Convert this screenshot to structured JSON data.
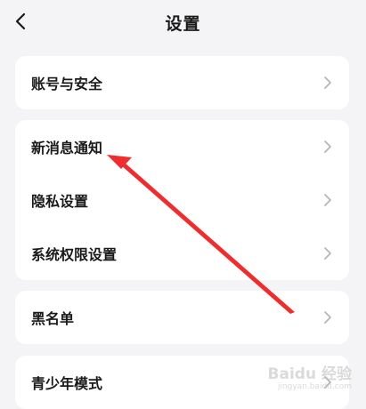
{
  "header": {
    "title": "设置",
    "back_icon": "chevron-left-icon"
  },
  "groups": [
    {
      "items": [
        {
          "label": "账号与安全"
        }
      ]
    },
    {
      "items": [
        {
          "label": "新消息通知"
        },
        {
          "label": "隐私设置"
        },
        {
          "label": "系统权限设置"
        }
      ]
    },
    {
      "items": [
        {
          "label": "黑名单"
        }
      ]
    },
    {
      "items": [
        {
          "label": "青少年模式"
        }
      ]
    }
  ],
  "annotation": {
    "arrow_color": "#ee2e2e",
    "points_to": "新消息通知"
  },
  "watermark": {
    "brand": "Baidu 经验",
    "url": "jingyan.baidu.com"
  },
  "colors": {
    "background": "#f4f4f6",
    "card": "#ffffff",
    "text": "#1a1a1a",
    "chevron": "#b5b5b5"
  }
}
